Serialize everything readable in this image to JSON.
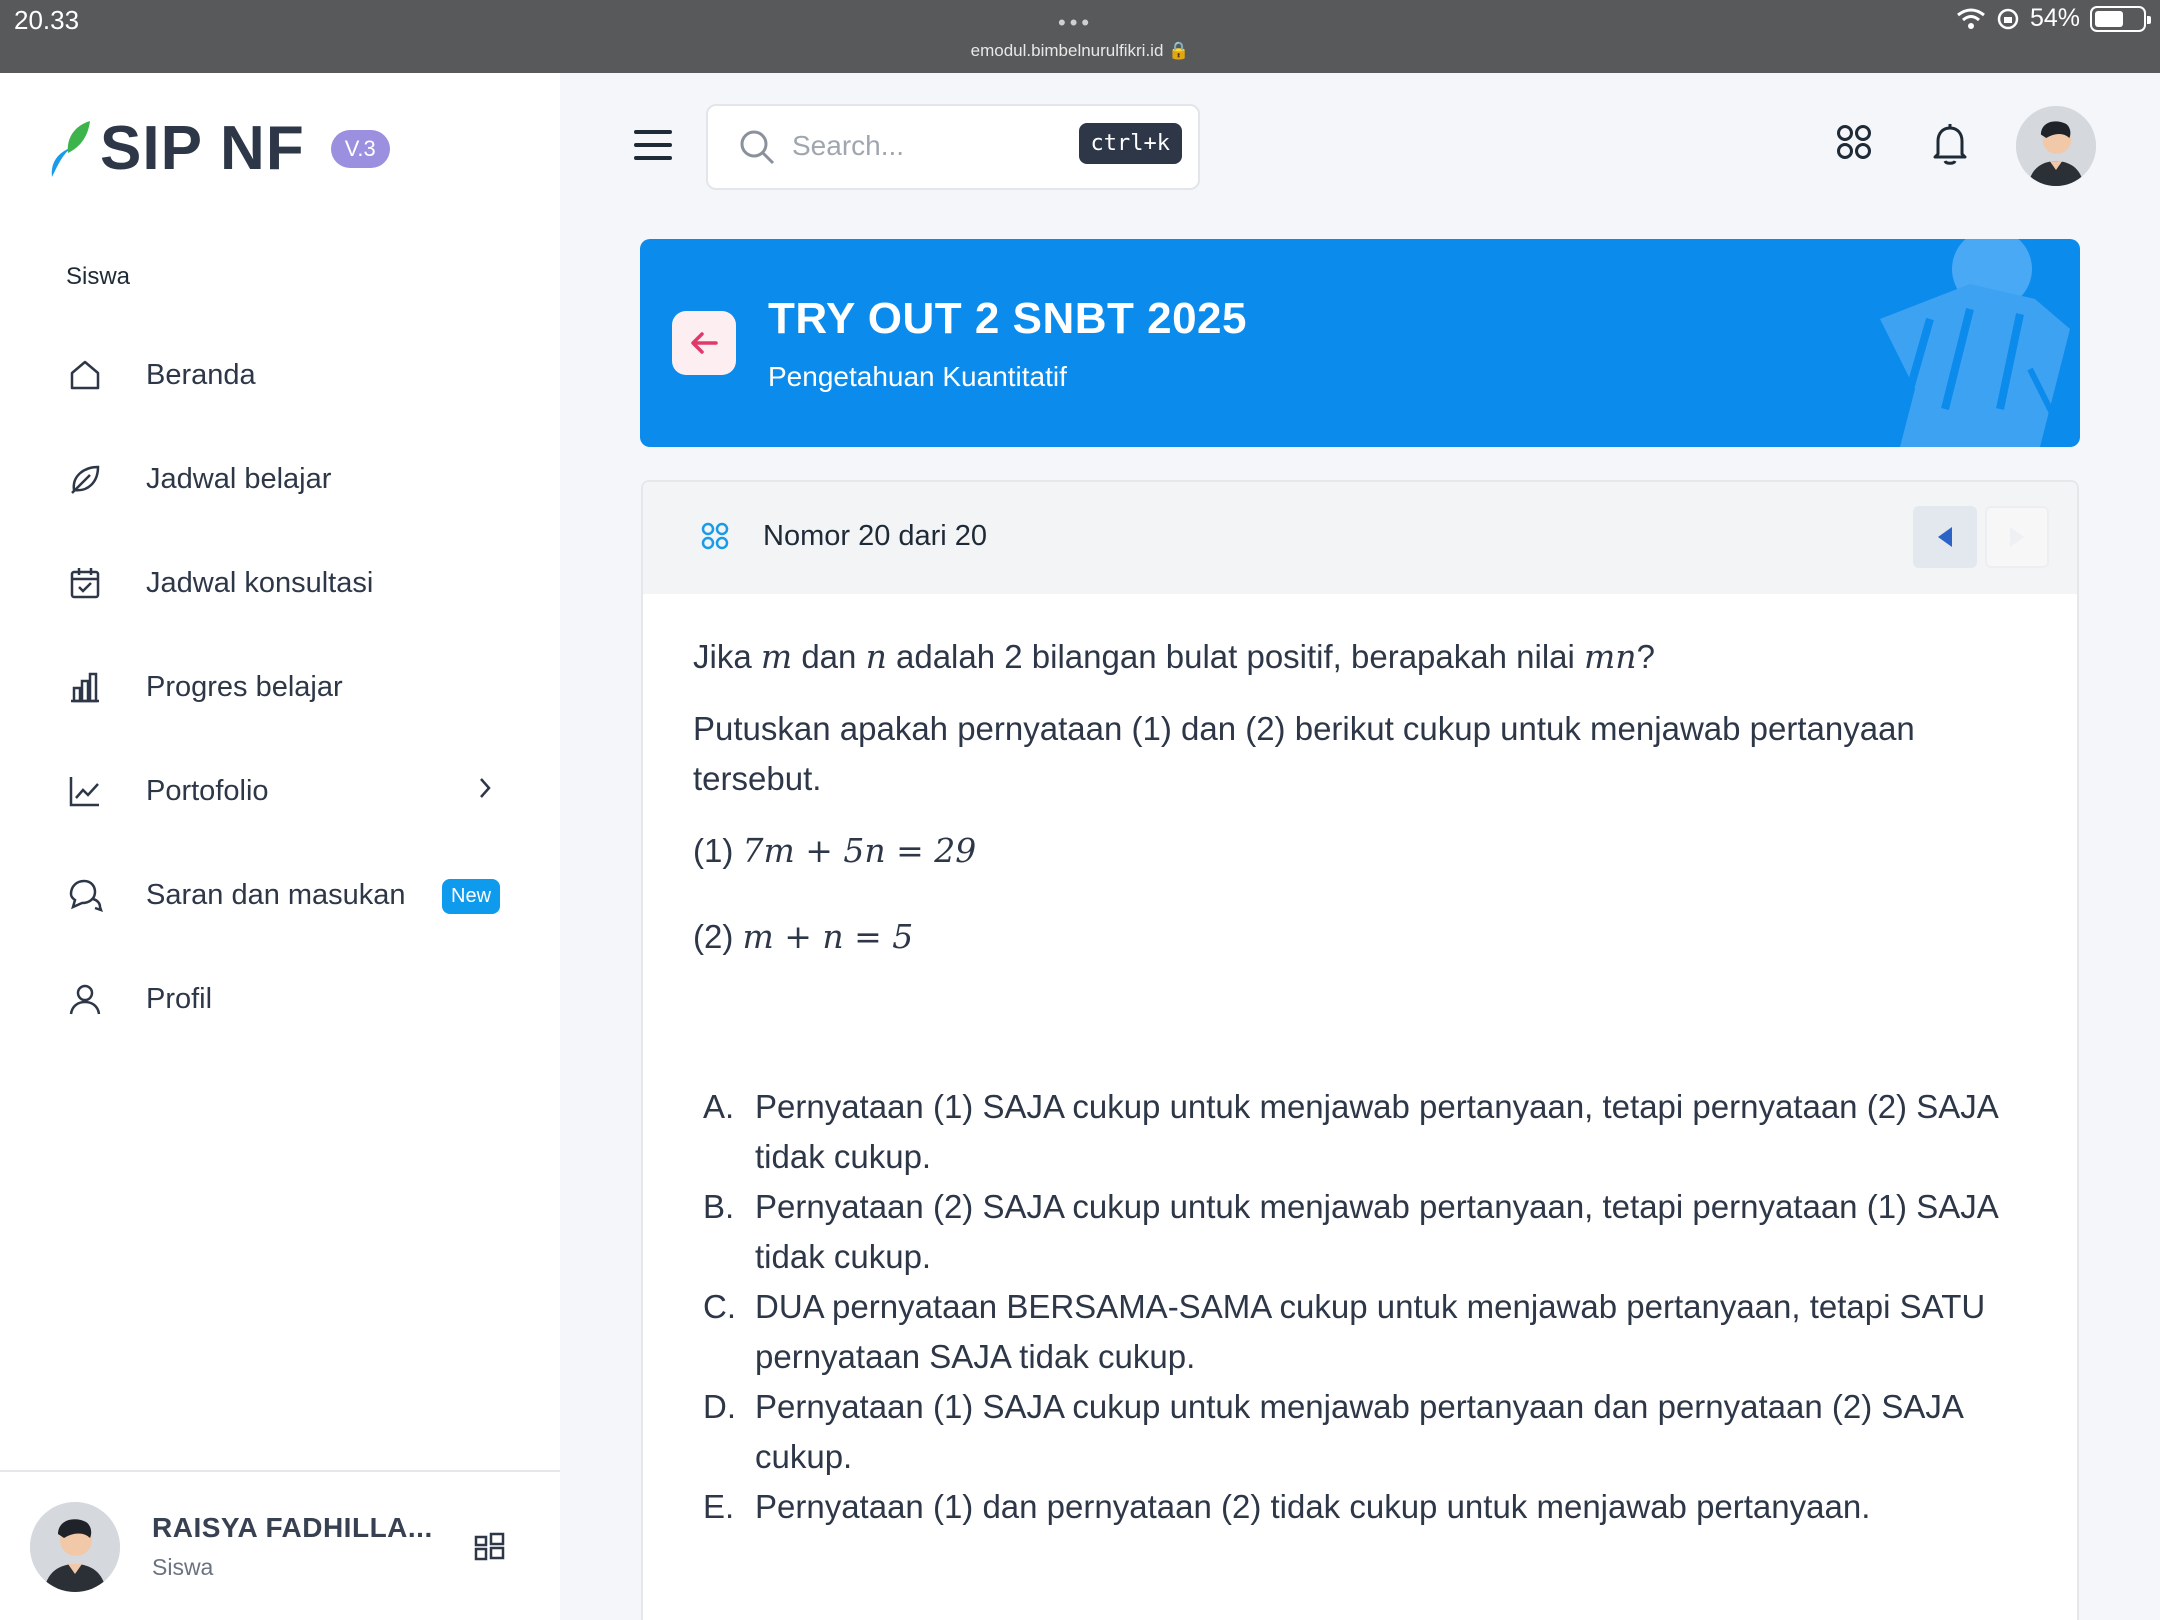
{
  "status_bar": {
    "time": "20.33",
    "dots": "•••",
    "url": "emodul.bimbelnurulfikri.id",
    "battery": "54%"
  },
  "sidebar": {
    "brand": "SIP NF",
    "version": "V.3",
    "section": "Siswa",
    "items": [
      {
        "label": "Beranda",
        "icon": "home-icon"
      },
      {
        "label": "Jadwal belajar",
        "icon": "leaf-icon"
      },
      {
        "label": "Jadwal konsultasi",
        "icon": "calendar-check-icon"
      },
      {
        "label": "Progres belajar",
        "icon": "bar-chart-icon"
      },
      {
        "label": "Portofolio",
        "icon": "trend-chart-icon"
      },
      {
        "label": "Saran dan masukan",
        "icon": "chat-icon",
        "badge": "New"
      },
      {
        "label": "Profil",
        "icon": "user-icon"
      }
    ],
    "user": {
      "name": "RAISYA FADHILLA...",
      "role": "Siswa"
    }
  },
  "topbar": {
    "search_placeholder": "Search...",
    "shortcut": "ctrl+k"
  },
  "banner": {
    "title": "TRY OUT 2 SNBT 2025",
    "subtitle": "Pengetahuan Kuantitatif",
    "color": "#0b8bec"
  },
  "question": {
    "counter": "Nomor 20 dari 20",
    "q_pre": "Jika ",
    "q_m": "m",
    "q_mid1": " dan ",
    "q_n": "n",
    "q_mid2": " adalah 2 bilangan bulat positif, berapakah nilai ",
    "q_mn": "mn",
    "q_end": "?",
    "instruction": "Putuskan apakah pernyataan (1) dan (2) berikut cukup untuk menjawab pertanyaan tersebut.",
    "s1_label": "(1) ",
    "s1_math": "7m + 5n = 29",
    "s2_label": "(2) ",
    "s2_math": "m + n = 5",
    "options": [
      {
        "letter": "A.",
        "text": "Pernyataan (1) SAJA cukup untuk menjawab pertanyaan, tetapi pernyataan (2) SAJA tidak cukup."
      },
      {
        "letter": "B.",
        "text": "Pernyataan (2) SAJA cukup untuk menjawab pertanyaan, tetapi pernyataan (1) SAJA tidak cukup."
      },
      {
        "letter": "C.",
        "text": "DUA pernyataan BERSAMA-SAMA cukup untuk menjawab pertanyaan, tetapi SATU pernyataan SAJA tidak cukup."
      },
      {
        "letter": "D.",
        "text": "Pernyataan (1) SAJA cukup untuk menjawab pertanyaan dan pernyataan (2) SAJA cukup."
      },
      {
        "letter": "E.",
        "text": "Pernyataan (1) dan pernyataan (2) tidak cukup untuk menjawab pertanyaan."
      }
    ]
  }
}
